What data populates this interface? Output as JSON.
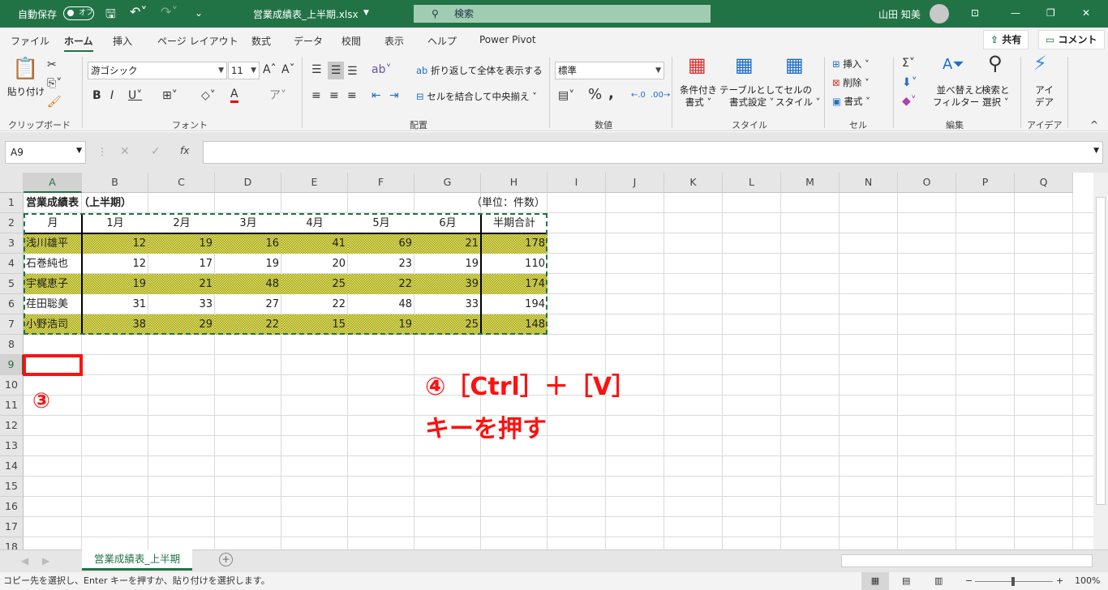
{
  "titlebar": {
    "autosave": "自動保存",
    "toggle": "オフ",
    "filename": "営業成績表_上半期.xlsx",
    "search": "検索",
    "user": "山田 知美"
  },
  "menu": [
    "ファイル",
    "ホーム",
    "挿入",
    "ページ レイアウト",
    "数式",
    "データ",
    "校閲",
    "表示",
    "ヘルプ",
    "Power Pivot"
  ],
  "share": "共有",
  "comment": "コメント",
  "ribbon": {
    "paste": "貼り付け",
    "font_name": "游ゴシック",
    "font_size": "11",
    "wrap": "折り返して全体を表示する",
    "merge": "セルを結合して中央揃え",
    "number_format": "標準",
    "cond1": "条件付き",
    "cond2": "書式",
    "table1": "テーブルとして",
    "table2": "書式設定",
    "style1": "セルの",
    "style2": "スタイル",
    "insert": "挿入",
    "delete": "削除",
    "format": "書式",
    "sort1": "並べ替えと",
    "sort2": "フィルター",
    "find1": "検索と",
    "find2": "選択",
    "idea1": "アイ",
    "idea2": "デア",
    "groups": [
      "クリップボード",
      "フォント",
      "配置",
      "数値",
      "スタイル",
      "セル",
      "編集",
      "アイデア"
    ]
  },
  "namebox": "A9",
  "fx": "fx",
  "columns": [
    "A",
    "B",
    "C",
    "D",
    "E",
    "F",
    "G",
    "H",
    "I",
    "J",
    "K",
    "L",
    "M",
    "N",
    "O",
    "P",
    "Q"
  ],
  "rows": [
    "1",
    "2",
    "3",
    "4",
    "5",
    "6",
    "7",
    "8",
    "9",
    "10",
    "11",
    "12",
    "13",
    "14",
    "15",
    "16",
    "17",
    "18"
  ],
  "table": {
    "title": "営業成績表（上半期）",
    "unit": "（単位：件数）",
    "headers": [
      "月",
      "1月",
      "2月",
      "3月",
      "4月",
      "5月",
      "6月",
      "半期合計"
    ],
    "data": [
      [
        "浅川雄平",
        "12",
        "19",
        "16",
        "41",
        "69",
        "21",
        "178"
      ],
      [
        "石巻純也",
        "12",
        "17",
        "19",
        "20",
        "23",
        "19",
        "110"
      ],
      [
        "宇梶恵子",
        "19",
        "21",
        "48",
        "25",
        "22",
        "39",
        "174"
      ],
      [
        "荏田聡美",
        "31",
        "33",
        "27",
        "22",
        "48",
        "33",
        "194"
      ],
      [
        "小野浩司",
        "38",
        "29",
        "22",
        "15",
        "19",
        "25",
        "148"
      ]
    ]
  },
  "sheet_tab": "営業成績表_上半期",
  "status": {
    "message": "コピー先を選択し、Enter キーを押すか、貼り付けを選択します。",
    "zoom": "100%"
  },
  "annotations": {
    "step3": "③",
    "step4": "④［Ctrl］＋［V］",
    "step4b": "キーを押す"
  },
  "colors": {
    "excel_green": "#217346",
    "annotation_red": "#ff1010"
  }
}
